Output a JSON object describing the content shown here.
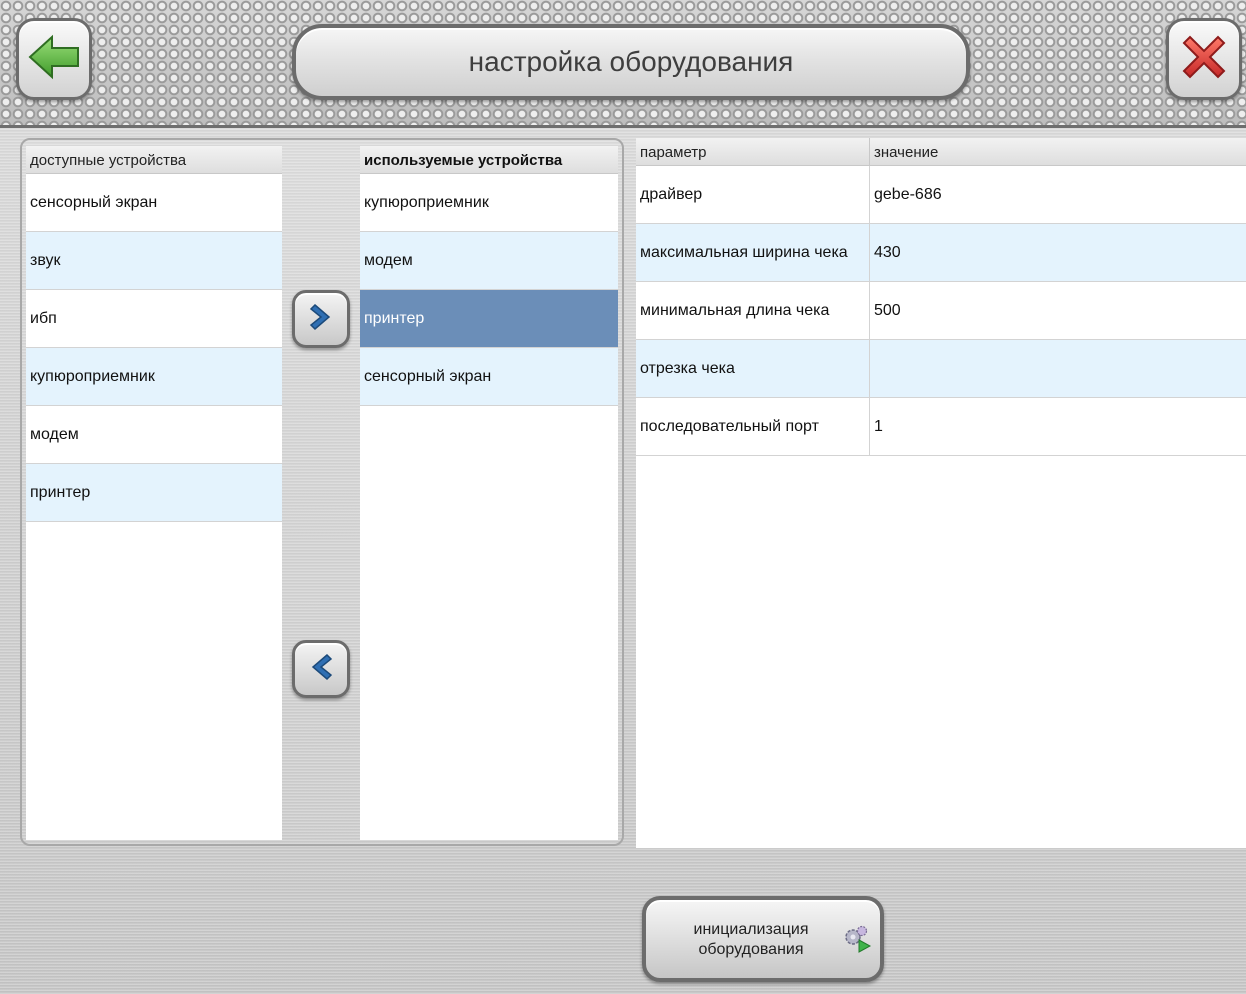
{
  "header": {
    "title": "настройка оборудования",
    "back_icon": "arrow-left-icon",
    "close_icon": "close-icon"
  },
  "available": {
    "header": "доступные устройства",
    "items": [
      {
        "label": "сенсорный экран"
      },
      {
        "label": "звук"
      },
      {
        "label": "ибп"
      },
      {
        "label": "купюроприемник"
      },
      {
        "label": "модем"
      },
      {
        "label": "принтер"
      }
    ]
  },
  "used": {
    "header": "используемые устройства",
    "items": [
      {
        "label": "купюроприемник"
      },
      {
        "label": "модем"
      },
      {
        "label": "принтер",
        "selected": true
      },
      {
        "label": "сенсорный экран"
      }
    ]
  },
  "params": {
    "col_param": "параметр",
    "col_value": "значение",
    "rows": [
      {
        "param": "драйвер",
        "value": "gebe-686"
      },
      {
        "param": "максимальная ширина чека",
        "value": "430"
      },
      {
        "param": "минимальная длина чека",
        "value": "500"
      },
      {
        "param": "отрезка чека",
        "value": ""
      },
      {
        "param": "последовательный порт",
        "value": "1"
      }
    ]
  },
  "init_button": {
    "line1": "инициализация",
    "line2": "оборудования",
    "icon": "gears-play-icon"
  },
  "colors": {
    "selected_row": "#6b8eb8",
    "alt_row": "#e4f3fd",
    "back_arrow": "#4caf50",
    "close_x": "#e53935"
  }
}
